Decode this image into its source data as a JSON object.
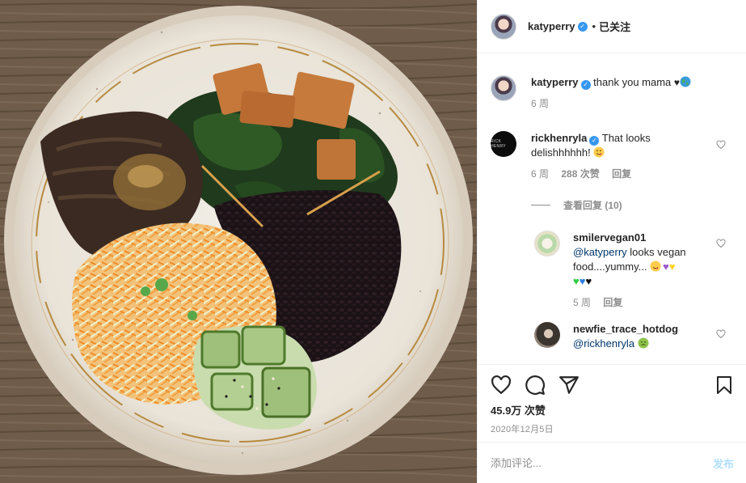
{
  "photo": {
    "alt": ""
  },
  "header": {
    "username": "katyperry",
    "separator": "•",
    "follow_label": "已关注"
  },
  "caption": {
    "username": "katyperry",
    "text": "thank you mama",
    "time": "6 周"
  },
  "comments": [
    {
      "username": "rickhenryla",
      "verified": true,
      "avatar_text": "RICK HENRY",
      "text": "That looks delishhhhhh!",
      "time": "6 周",
      "likes": "288 次赞",
      "reply": "回复"
    },
    {
      "username": "smilervegan01",
      "mention": "@katyperry",
      "text": " looks vegan food....yummy...",
      "time": "5 周",
      "reply": "回复"
    },
    {
      "username": "newfie_trace_hotdog",
      "mention": "@rickhenryla",
      "text": ""
    }
  ],
  "view_replies": "查看回复 (10)",
  "actions": {
    "likes": "45.9万 次赞",
    "date": "2020年12月5日"
  },
  "add_comment": {
    "placeholder": "添加评论...",
    "post_label": "发布"
  },
  "colors": {
    "link": "#00376b",
    "verified": "#3897f0",
    "secondary": "#8e8e8e",
    "post_disabled": "#b2dffc"
  },
  "icons": [
    "verified-badge-icon",
    "heart-icon",
    "comment-icon",
    "share-icon",
    "bookmark-icon",
    "emoji-icon"
  ]
}
